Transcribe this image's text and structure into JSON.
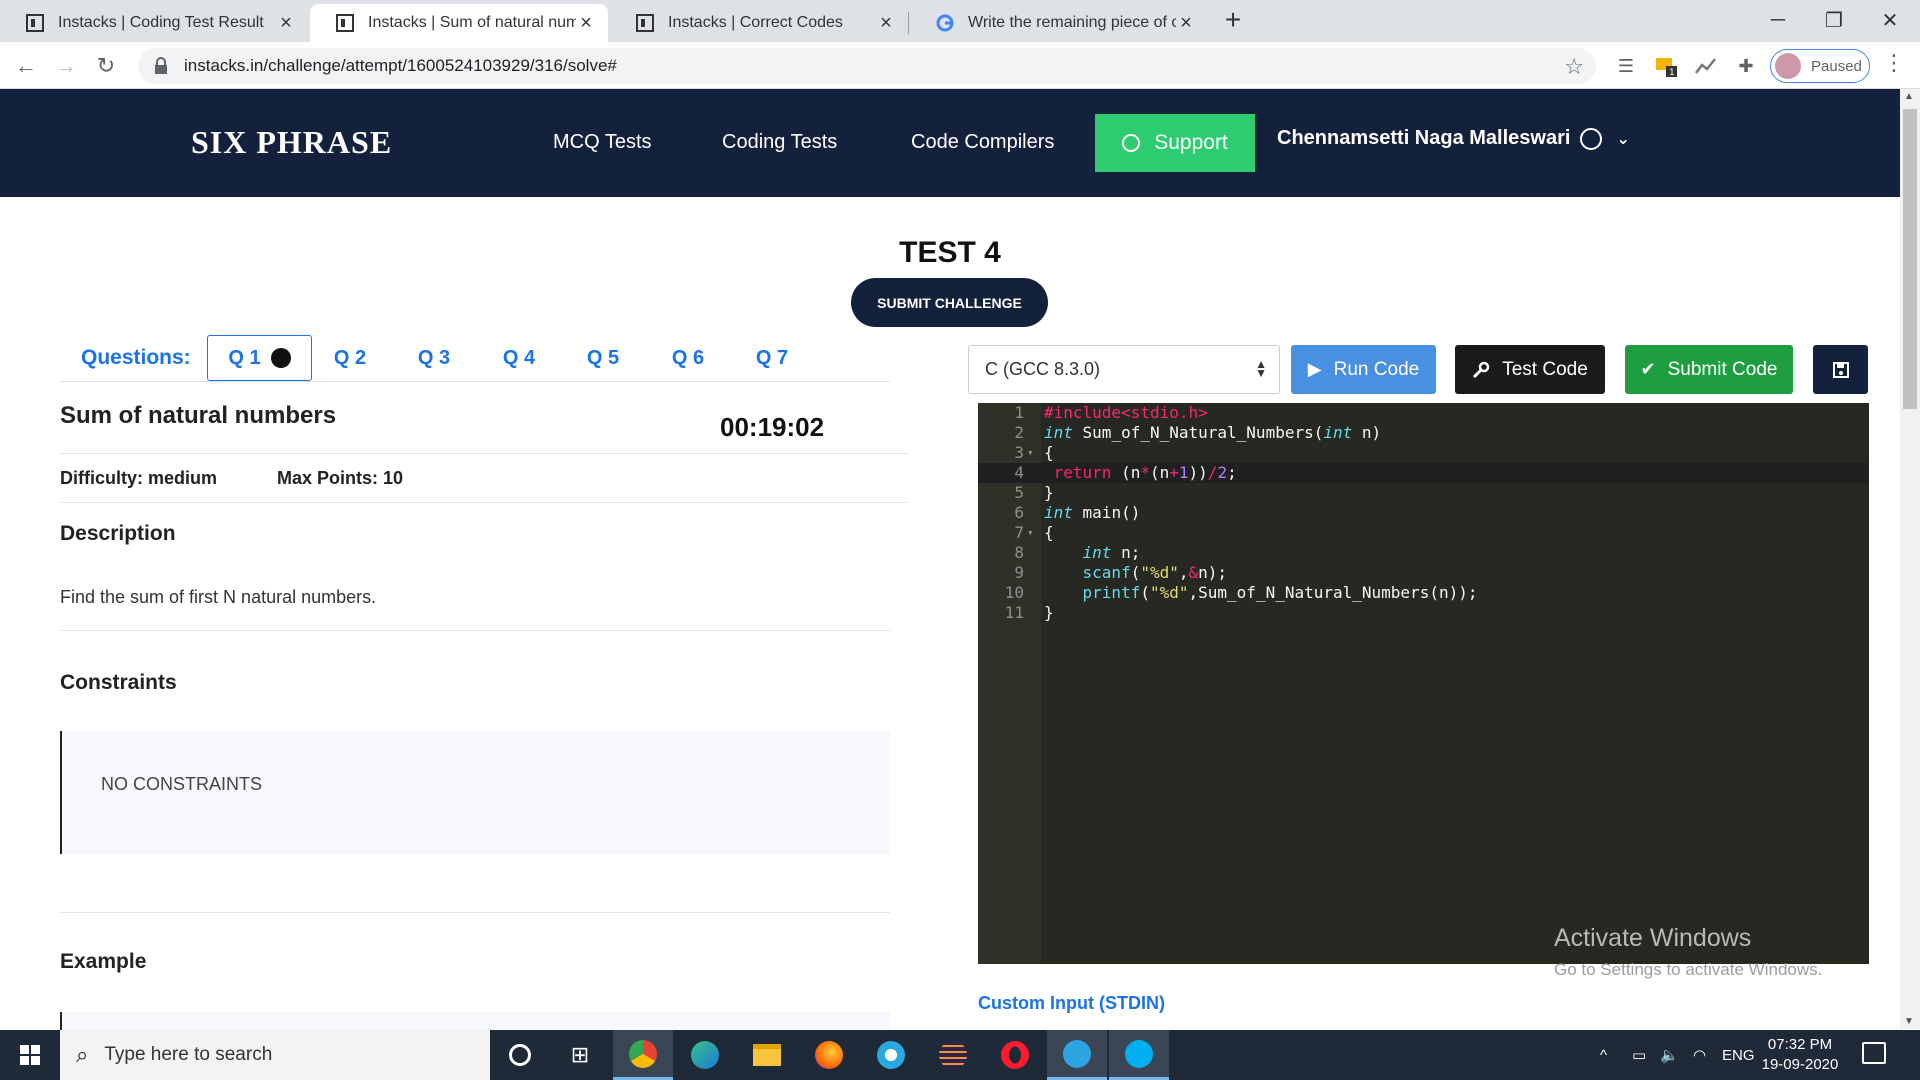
{
  "browser": {
    "tabs": [
      {
        "title": "Instacks | Coding Test Result",
        "active": false
      },
      {
        "title": "Instacks | Sum of natural number",
        "active": true
      },
      {
        "title": "Instacks | Correct Codes",
        "active": false
      },
      {
        "title": "Write the remaining piece of cod",
        "active": false
      }
    ],
    "url": "instacks.in/challenge/attempt/1600524103929/316/solve#",
    "profile_status": "Paused",
    "extension_badge": "1"
  },
  "site": {
    "logo": "SIX PHRASE",
    "nav": [
      "MCQ Tests",
      "Coding Tests",
      "Code Compilers"
    ],
    "support_label": "Support",
    "user_name": "Chennamsetti Naga Malleswari",
    "brand_color": "#14213d",
    "support_color": "#2ecc71"
  },
  "test": {
    "title": "TEST 4",
    "submit_challenge_label": "SUBMIT CHALLENGE",
    "questions_label": "Questions:",
    "questions": [
      "Q 1",
      "Q 2",
      "Q 3",
      "Q 4",
      "Q 5",
      "Q 6",
      "Q 7"
    ],
    "active_question": "Q 1"
  },
  "problem": {
    "title": "Sum of natural numbers",
    "timer": "00:19:02",
    "difficulty": "Difficulty: medium",
    "max_points": "Max Points: 10",
    "description_heading": "Description",
    "description_text": "Find the sum of first N natural numbers.",
    "constraints_heading": "Constraints",
    "constraints_text": "NO CONSTRAINTS",
    "example_heading": "Example"
  },
  "editor": {
    "language": "C (GCC 8.3.0)",
    "run_label": "Run Code",
    "test_label": "Test Code",
    "submit_label": "Submit Code",
    "line_numbers": [
      "1",
      "2",
      "3",
      "4",
      "5",
      "6",
      "7",
      "8",
      "9",
      "10",
      "11"
    ],
    "code_lines": [
      "#include<stdio.h>",
      "int Sum_of_N_Natural_Numbers(int n)",
      "{",
      " return (n*(n+1))/2;",
      "}",
      "int main()",
      "{",
      "    int n;",
      "    scanf(\"%d\",&n);",
      "    printf(\"%d\",Sum_of_N_Natural_Numbers(n));",
      "}"
    ],
    "custom_input_label": "Custom Input (STDIN)"
  },
  "watermark": {
    "line1": "Activate Windows",
    "line2": "Go to Settings to activate Windows."
  },
  "taskbar": {
    "search_placeholder": "Type here to search",
    "time": "07:32 PM",
    "date": "19-09-2020",
    "language": "ENG"
  }
}
